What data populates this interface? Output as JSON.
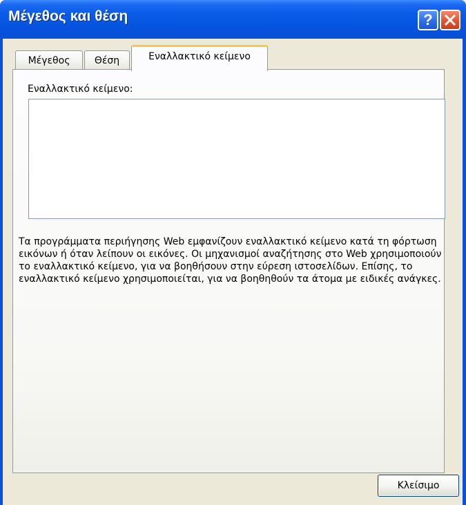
{
  "window": {
    "title": "Μέγεθος και θέση",
    "help_glyph": "?",
    "help_icon": "help-icon",
    "close_icon": "close-icon"
  },
  "tabs": [
    {
      "label": "Μέγεθος",
      "selected": false
    },
    {
      "label": "Θέση",
      "selected": false
    },
    {
      "label": "Εναλλακτικό κείμενο",
      "selected": true
    }
  ],
  "alt_text": {
    "label": "Εναλλακτικό κείμενο:",
    "value": "",
    "description": "Τα προγράμματα περιήγησης Web εμφανίζουν εναλλακτικό κείμενο κατά τη φόρτωση εικόνων ή όταν λείπουν οι εικόνες. Οι μηχανισμοί αναζήτησης στο Web χρησιμοποιούν το εναλλακτικό κείμενο, για να βοηθήσουν στην εύρεση ιστοσελίδων. Επίσης, το εναλλακτικό κείμενο χρησιμοποιείται, για να βοηθηθούν τα άτομα με ειδικές ανάγκες."
  },
  "footer": {
    "close_label": "Κλείσιμο"
  },
  "colors": {
    "titlebar": "#0653df",
    "tab_highlight": "#ffc83c",
    "dialog_bg": "#ece9d8",
    "close_button": "#e2552e"
  }
}
